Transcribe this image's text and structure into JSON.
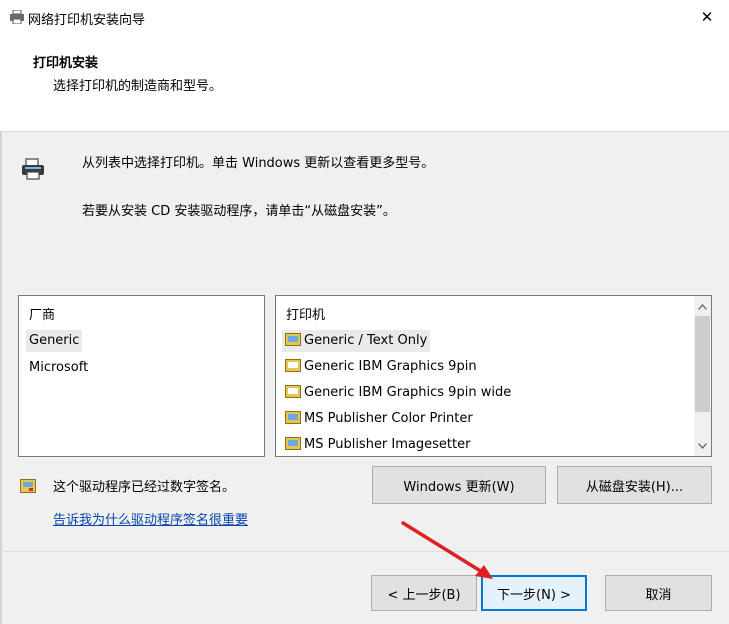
{
  "window": {
    "title": "网络打印机安装向导",
    "close_glyph": "✕"
  },
  "header": {
    "title": "打印机安装",
    "subtitle": "选择打印机的制造商和型号。"
  },
  "instructions": {
    "line1": "从列表中选择打印机。单击 Windows 更新以查看更多型号。",
    "line2": "若要从安装 CD 安装驱动程序，请单击“从磁盘安装”。"
  },
  "manufacturer_list": {
    "header": "厂商",
    "items": [
      "Generic",
      "Microsoft"
    ],
    "selected": "Generic"
  },
  "printer_list": {
    "header": "打印机",
    "items": [
      "Generic / Text Only",
      "Generic IBM Graphics 9pin",
      "Generic IBM Graphics 9pin wide",
      "MS Publisher Color Printer",
      "MS Publisher Imagesetter"
    ],
    "selected": "Generic / Text Only"
  },
  "signature": {
    "status": "这个驱动程序已经过数字签名。",
    "link": "告诉我为什么驱动程序签名很重要"
  },
  "buttons": {
    "windows_update": "Windows 更新(W)",
    "have_disk": "从磁盘安装(H)...",
    "back": "< 上一步(B)",
    "next": "下一步(N) >",
    "cancel": "取消"
  },
  "colors": {
    "accent": "#0078d7",
    "annotation_arrow": "#e02020",
    "link": "#0645ad"
  },
  "icons": [
    "printer-icon",
    "close-icon",
    "driver-icon",
    "certificate-icon",
    "scroll-up-icon",
    "scroll-down-icon"
  ]
}
